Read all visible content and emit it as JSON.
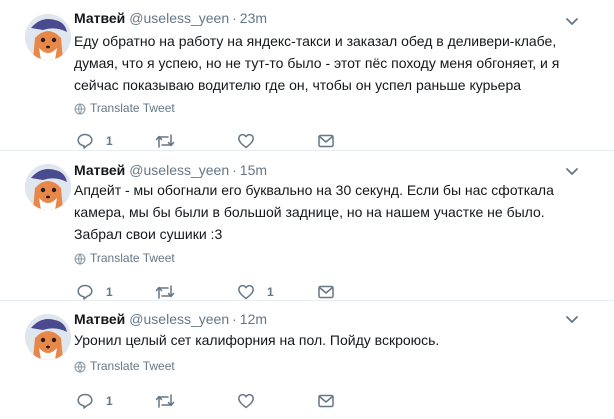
{
  "tweets": [
    {
      "name": "Матвей",
      "handle": "@useless_yeen",
      "dot": "·",
      "time": "23m",
      "text": "Еду обратно на работу на яндекс-такси и заказал обед в деливери-клабе, думая, что я успею, но не тут-то было - этот пёс походу меня обгоняет, и я сейчас показываю водителю где он, чтобы он успел раньше курьера",
      "translate": "Translate Tweet",
      "reply_count": "1",
      "retweet_count": "",
      "like_count": ""
    },
    {
      "name": "Матвей",
      "handle": "@useless_yeen",
      "dot": "·",
      "time": "15m",
      "text": "Апдейт - мы обогнали его буквально на 30 секунд. Если бы нас сфоткала камера, мы бы были в большой заднице, но на нашем участке не было. Забрал свои сушики :3",
      "translate": "Translate Tweet",
      "reply_count": "1",
      "retweet_count": "",
      "like_count": "1"
    },
    {
      "name": "Матвей",
      "handle": "@useless_yeen",
      "dot": "·",
      "time": "12m",
      "text": "Уронил целый сет калифорния на пол. Пойду вскроюсь.",
      "translate": "Translate Tweet",
      "reply_count": "1",
      "retweet_count": "",
      "like_count": ""
    }
  ],
  "icons": {
    "reply": "reply-icon",
    "retweet": "retweet-icon",
    "like": "heart-icon",
    "dm": "envelope-icon",
    "more": "chevron-down-icon",
    "translate": "globe-icon"
  },
  "colors": {
    "text": "#14171a",
    "secondary": "#657786",
    "divider": "#e6ecf0",
    "avatar_fur": "#e8874a",
    "avatar_hair": "#4b4a8f"
  }
}
